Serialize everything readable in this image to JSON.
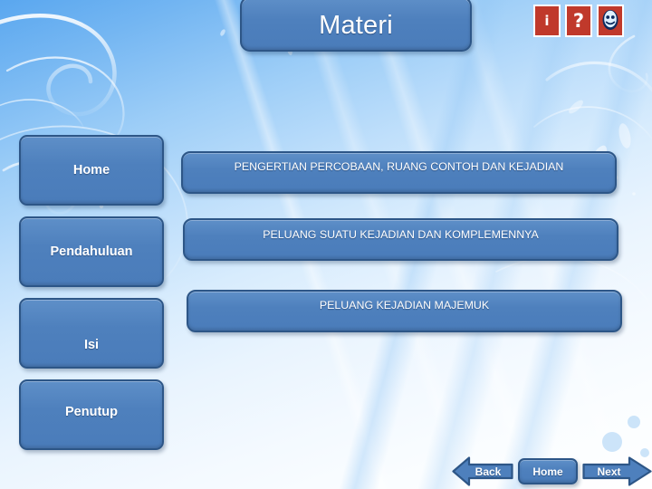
{
  "slide": {
    "title": "Materi",
    "background_color": "#9ccdf7",
    "accent_color": "#4e80bd",
    "accent_border_color": "#2d5687",
    "icon_color": "#c0392b"
  },
  "header": {
    "title": "Materi",
    "icons": [
      {
        "name": "info-icon",
        "glyph": "i",
        "label": "Information"
      },
      {
        "name": "help-icon",
        "glyph": "?",
        "label": "Help"
      },
      {
        "name": "face-icon",
        "glyph": "☻",
        "label": "Profile"
      }
    ]
  },
  "sidebar": {
    "items": [
      {
        "label": "Home"
      },
      {
        "label": "Pendahuluan"
      },
      {
        "label": "Isi"
      },
      {
        "label": "Penutup"
      }
    ]
  },
  "main": {
    "topics": [
      {
        "label": "PENGERTIAN PERCOBAAN, RUANG CONTOH  DAN KEJADIAN"
      },
      {
        "label": "PELUANG SUATU KEJADIAN DAN KOMPLEMENNYA"
      },
      {
        "label": "PELUANG KEJADIAN MAJEMUK"
      }
    ]
  },
  "footer": {
    "back_label": "Back",
    "home_label": "Home",
    "next_label": "Next"
  }
}
